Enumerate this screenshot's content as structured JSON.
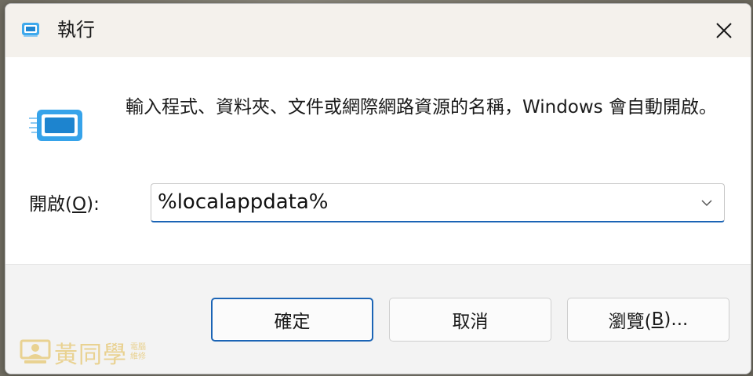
{
  "window": {
    "title": "執行",
    "close_icon": "close-icon"
  },
  "content": {
    "description": "輸入程式、資料夾、文件或網際網路資源的名稱，Windows 會自動開啟。",
    "open_label_prefix": "開啟(",
    "open_label_accel": "O",
    "open_label_suffix": "):",
    "combo_value": "%localappdata%"
  },
  "buttons": {
    "ok": "確定",
    "cancel": "取消",
    "browse_prefix": "瀏覽(",
    "browse_accel": "B",
    "browse_suffix": ")..."
  },
  "watermark": {
    "main": "黃同學",
    "small_line1": "電腦",
    "small_line2": "維修"
  },
  "colors": {
    "accent": "#1b64b5",
    "icon_blue": "#2e9be0",
    "watermark": "#e1b640"
  }
}
